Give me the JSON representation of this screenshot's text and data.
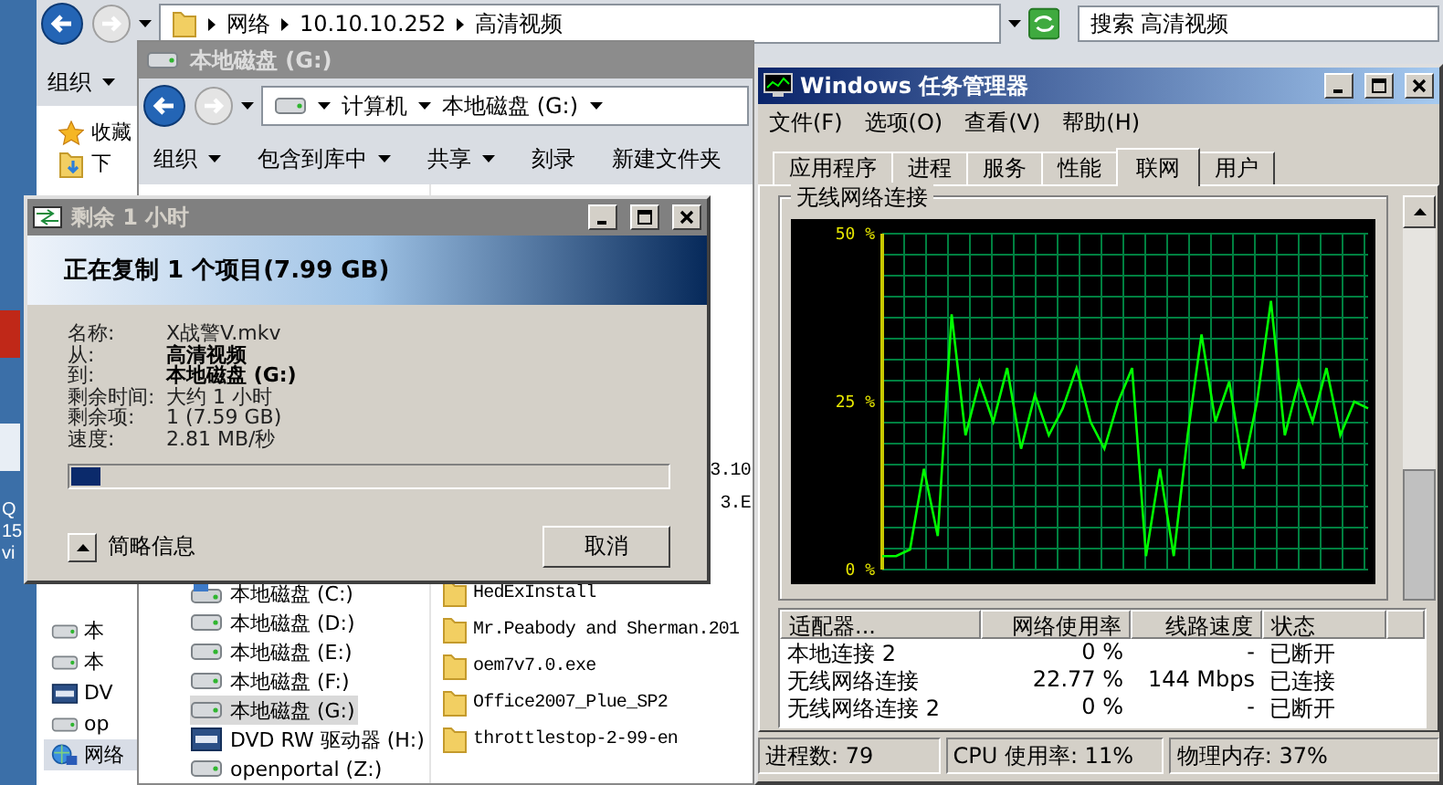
{
  "desktop": {
    "labels": [
      "Q",
      "15",
      "vi"
    ]
  },
  "explorer_back": {
    "address": [
      "网络",
      "10.10.10.252",
      "高清视频"
    ],
    "search": {
      "placeholder": "搜索 高清视频"
    },
    "toolbar": [
      "组织"
    ],
    "favorites": [
      {
        "label": "收藏",
        "kind": "star"
      },
      {
        "label": "下",
        "kind": "download"
      }
    ],
    "nav_items": [
      {
        "label": "本",
        "kind": "drive"
      },
      {
        "label": "本",
        "kind": "drive"
      },
      {
        "label": "DV",
        "kind": "dvd"
      },
      {
        "label": "op",
        "kind": "drive"
      },
      {
        "label": "网络",
        "kind": "network"
      }
    ]
  },
  "explorer_disk": {
    "title": "本地磁盘 (G:)",
    "address": [
      "计算机",
      "本地磁盘 (G:)"
    ],
    "toolbar": [
      {
        "label": "组织",
        "menu": true
      },
      {
        "label": "包含到库中",
        "menu": true
      },
      {
        "label": "共享",
        "menu": true
      },
      {
        "label": "刻录",
        "menu": false
      },
      {
        "label": "新建文件夹",
        "menu": false
      }
    ],
    "drives": [
      {
        "label": "本地磁盘 (C:)",
        "kind": "system",
        "selected": false
      },
      {
        "label": "本地磁盘 (D:)",
        "kind": "drive",
        "selected": false
      },
      {
        "label": "本地磁盘 (E:)",
        "kind": "drive",
        "selected": false
      },
      {
        "label": "本地磁盘 (F:)",
        "kind": "drive",
        "selected": false
      },
      {
        "label": "本地磁盘 (G:)",
        "kind": "drive",
        "selected": true
      },
      {
        "label": "DVD RW 驱动器 (H:)",
        "kind": "dvd",
        "selected": false
      },
      {
        "label": "openportal (Z:)",
        "kind": "drive",
        "selected": false
      }
    ],
    "file_fragments": [
      "3.10",
      "3.E"
    ],
    "files": [
      "HedExInstall",
      "Mr.Peabody and Sherman.201",
      "oem7v7.0.exe",
      "Office2007_Plue_SP2",
      "throttlestop-2-99-en"
    ]
  },
  "copy_dialog": {
    "title": "剩余 1 小时",
    "heading": "正在复制 1 个项目(7.99 GB)",
    "details": [
      {
        "label": "名称:",
        "value": "X战警V.mkv",
        "bold": false
      },
      {
        "label": "从:",
        "value": "高清视频",
        "bold": true
      },
      {
        "label": "到:",
        "value": "本地磁盘 (G:)",
        "bold": true
      },
      {
        "label": "剩余时间:",
        "value": "大约 1 小时",
        "bold": false
      },
      {
        "label": "剩余项:",
        "value": "1 (7.59 GB)",
        "bold": false
      },
      {
        "label": "速度:",
        "value": "2.81 MB/秒",
        "bold": false
      }
    ],
    "progress": {
      "level": 0.05
    },
    "toggle_label": "简略信息",
    "cancel_label": "取消"
  },
  "task_manager": {
    "title": "Windows 任务管理器",
    "menu": [
      "文件(F)",
      "选项(O)",
      "查看(V)",
      "帮助(H)"
    ],
    "tabs": [
      {
        "label": "应用程序",
        "selected": false
      },
      {
        "label": "进程",
        "selected": false
      },
      {
        "label": "服务",
        "selected": false
      },
      {
        "label": "性能",
        "selected": false
      },
      {
        "label": "联网",
        "selected": true
      },
      {
        "label": "用户",
        "selected": false
      }
    ],
    "chart_data": {
      "type": "line",
      "grid": true,
      "ylim": [
        0,
        50
      ],
      "yticks": [
        {
          "value": 0,
          "label": "0 %"
        },
        {
          "value": 25,
          "label": "25 %"
        },
        {
          "value": 50,
          "label": "50 %"
        }
      ],
      "series": [
        {
          "name": "无线网络连接",
          "color": "#00ff00",
          "values": [
            2,
            2,
            3,
            15,
            5,
            38,
            20,
            28,
            22,
            30,
            18,
            26,
            20,
            24,
            30,
            22,
            18,
            25,
            30,
            2,
            15,
            2,
            20,
            35,
            22,
            28,
            15,
            25,
            40,
            20,
            28,
            22,
            30,
            20,
            25,
            24
          ]
        }
      ]
    },
    "table": {
      "columns": [
        "适配器...",
        "网络使用率",
        "线路速度",
        "状态"
      ],
      "rows": [
        [
          "本地连接 2",
          "0 %",
          "-",
          "已断开"
        ],
        [
          "无线网络连接",
          "22.77 %",
          "144 Mbps",
          "已连接"
        ],
        [
          "无线网络连接 2",
          "0 %",
          "-",
          "已断开"
        ]
      ]
    },
    "status": [
      "进程数: 79",
      "CPU 使用率: 11%",
      "物理内存: 37%"
    ]
  }
}
